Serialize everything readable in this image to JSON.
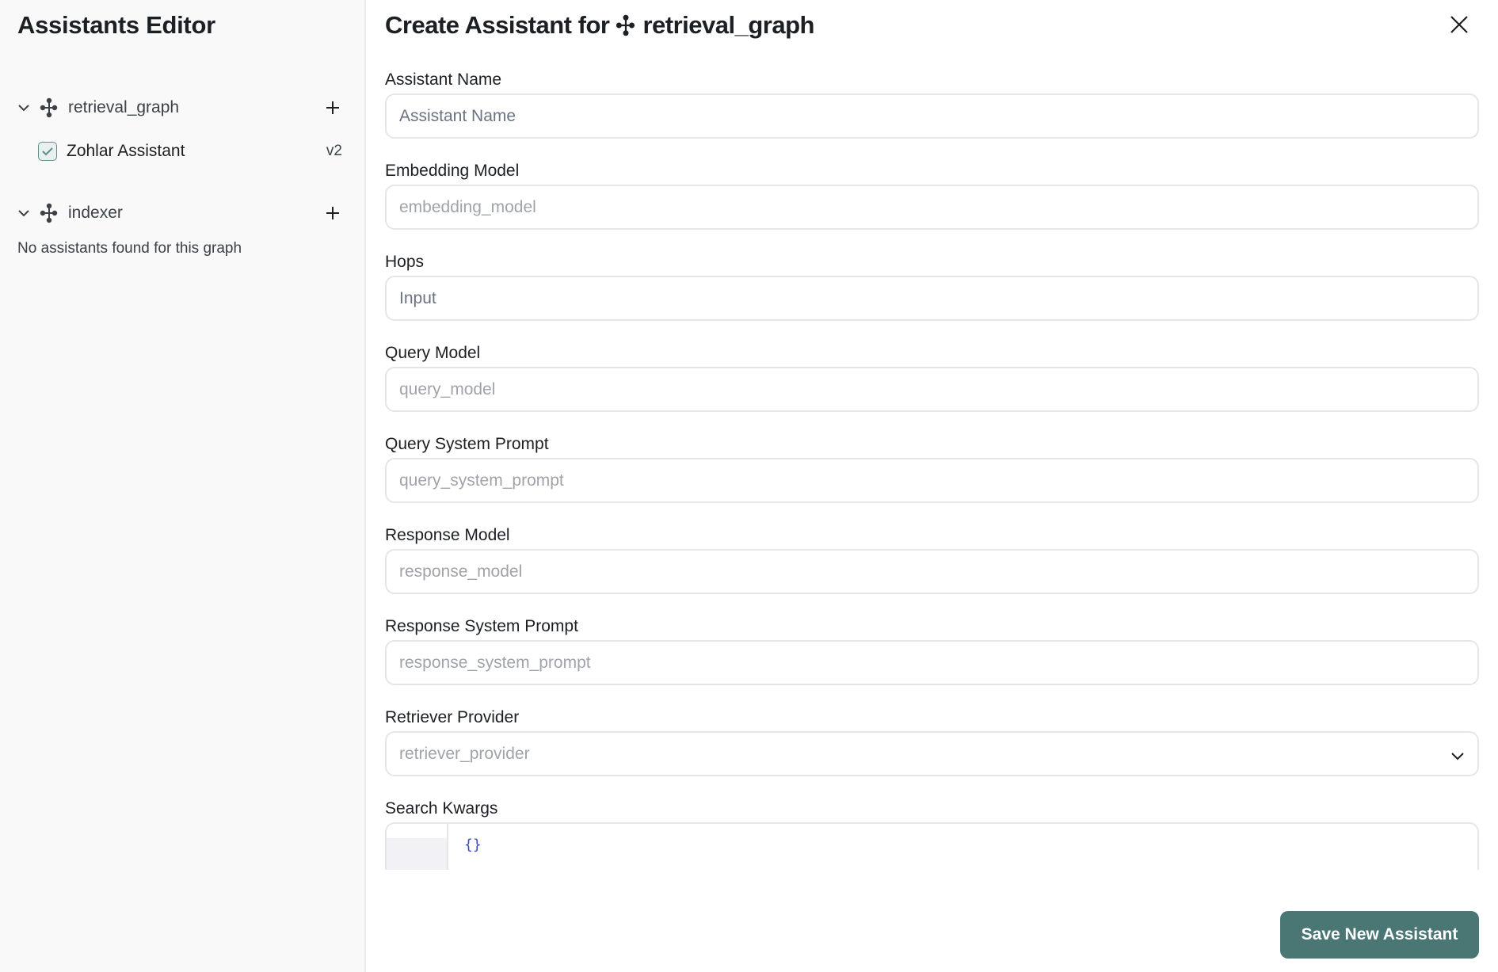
{
  "sidebar": {
    "title": "Assistants Editor",
    "graphs": [
      {
        "name": "retrieval_graph",
        "icon": "graph-nodes-icon",
        "expanded": true,
        "assistants": [
          {
            "name": "Zohlar Assistant",
            "version": "v2",
            "checked": true
          }
        ]
      },
      {
        "name": "indexer",
        "icon": "graph-nodes-icon",
        "expanded": true,
        "assistants": [],
        "empty_message": "No assistants found for this graph"
      }
    ]
  },
  "main": {
    "title_prefix": "Create Assistant for",
    "graph_name": "retrieval_graph",
    "fields": [
      {
        "label": "Assistant Name",
        "placeholder": "Assistant Name",
        "type": "text"
      },
      {
        "label": "Embedding Model",
        "placeholder": "embedding_model",
        "type": "text"
      },
      {
        "label": "Hops",
        "placeholder": "Input",
        "type": "number"
      },
      {
        "label": "Query Model",
        "placeholder": "query_model",
        "type": "text"
      },
      {
        "label": "Query System Prompt",
        "placeholder": "query_system_prompt",
        "type": "text"
      },
      {
        "label": "Response Model",
        "placeholder": "response_model",
        "type": "text"
      },
      {
        "label": "Response System Prompt",
        "placeholder": "response_system_prompt",
        "type": "text"
      },
      {
        "label": "Retriever Provider",
        "placeholder": "retriever_provider",
        "type": "select"
      },
      {
        "label": "Search Kwargs",
        "value": "{}",
        "type": "code"
      }
    ],
    "save_label": "Save New Assistant"
  },
  "colors": {
    "accent": "#4a7674",
    "sidebar_bg": "#f9f9f9",
    "border": "#e6e6e6",
    "checkbox_border": "#5c8f8a"
  }
}
